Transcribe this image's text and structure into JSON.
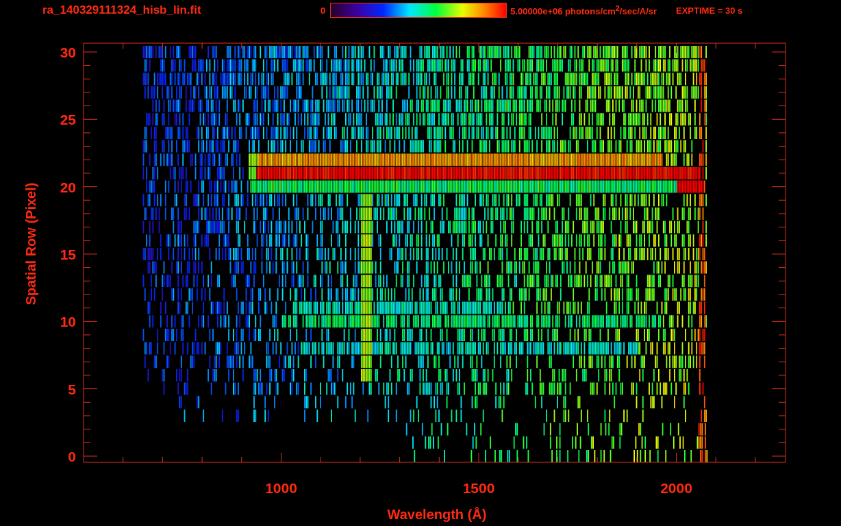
{
  "header": {
    "title": "ra_140329111324_hisb_lin.fit",
    "colorbar": {
      "min_label": "0",
      "max_label": "5.00000e+06 photons/cm$^{2}$/sec/A/sr"
    },
    "exposure": "EXPTIME = 30 s"
  },
  "plot": {
    "x_axis": {
      "title": "Wavelength (Å)",
      "tick_labels": [
        "1000",
        "1500",
        "2000"
      ]
    },
    "y_axis": {
      "title": "Spatial Row (Pixel)",
      "tick_labels": [
        "30",
        "25",
        "20",
        "15",
        "10",
        "5",
        "0"
      ]
    }
  }
}
